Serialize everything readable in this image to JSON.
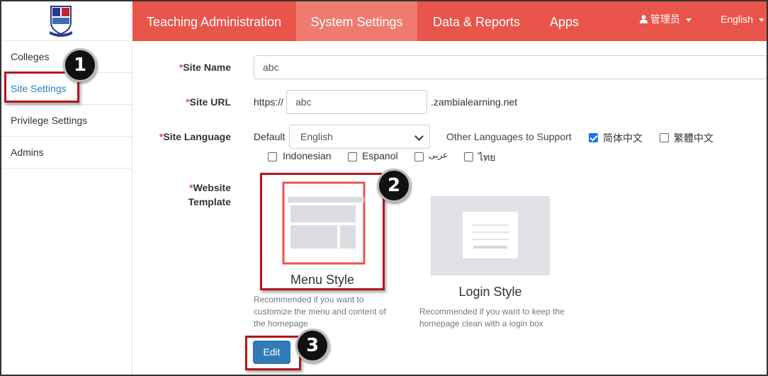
{
  "topnav": {
    "items": [
      {
        "label": "Teaching Administration"
      },
      {
        "label": "System Settings"
      },
      {
        "label": "Data & Reports"
      },
      {
        "label": "Apps"
      }
    ],
    "user_label": "管理员",
    "language_label": "English"
  },
  "sidebar": {
    "items": [
      {
        "label": "Colleges"
      },
      {
        "label": "Site Settings"
      },
      {
        "label": "Privilege Settings"
      },
      {
        "label": "Admins"
      }
    ]
  },
  "form": {
    "site_name": {
      "label": "Site Name",
      "required_mark": "*",
      "value": "abc"
    },
    "site_url": {
      "label": "Site URL",
      "required_mark": "*",
      "prefix": "https://",
      "value": "abc",
      "suffix": ".zambialearning.net"
    },
    "site_language": {
      "label": "Site Language",
      "required_mark": "*",
      "default_label": "Default",
      "default_value": "English",
      "other_label": "Other Languages to Support",
      "options": [
        {
          "label": "简体中文",
          "checked": true
        },
        {
          "label": "繁體中文",
          "checked": false
        },
        {
          "label": "Indonesian",
          "checked": false
        },
        {
          "label": "Espanol",
          "checked": false
        },
        {
          "label": "عربى",
          "checked": false
        },
        {
          "label": "ไทย",
          "checked": false
        }
      ]
    },
    "website_template": {
      "label_line1": "Website",
      "label_line2": "Template",
      "required_mark": "*",
      "templates": [
        {
          "title": "Menu Style",
          "description": "Recommended if you want to customize the menu and content of the homepage"
        },
        {
          "title": "Login Style",
          "description": "Recommended if you want to keep the homepage clean with a login box"
        }
      ]
    },
    "edit_label": "Edit"
  },
  "callouts": [
    "1",
    "2",
    "3"
  ],
  "colors": {
    "accent": "#e9554a",
    "accent_active": "#ef7a70",
    "link": "#2f7dc0",
    "highlight": "#b5161b",
    "primary_button": "#337ab7"
  }
}
